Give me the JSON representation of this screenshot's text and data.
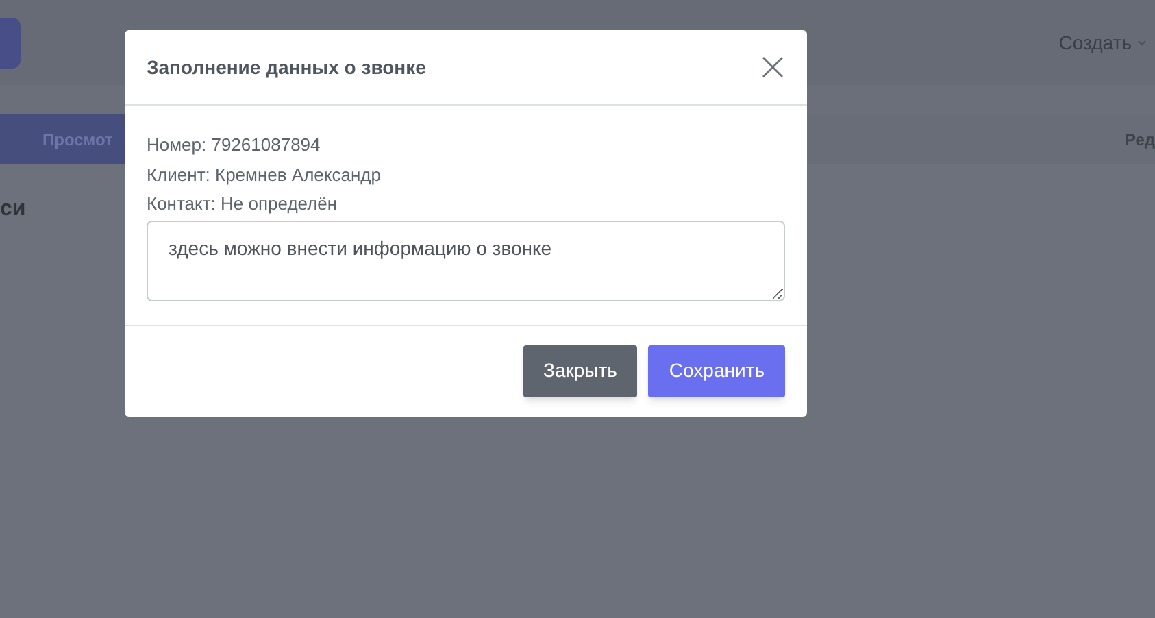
{
  "background": {
    "header": {
      "create_menu": "Создать"
    },
    "tab_bar": {
      "tabs": [
        {
          "label": "Просмот"
        },
        {
          "label": "Ред"
        }
      ]
    },
    "section_title": "си"
  },
  "dialog": {
    "title": "Заполнение данных о звонке",
    "lines": [
      "Номер: 79261087894",
      "Клиент: Кремнев Александр",
      "Контакт: Не определён"
    ],
    "note": {
      "value": "здесь можно внести информацию о звонке"
    },
    "buttons": [
      {
        "label": "Закрыть",
        "kind": "secondary"
      },
      {
        "label": "Сохранить",
        "kind": "primary"
      }
    ]
  }
}
